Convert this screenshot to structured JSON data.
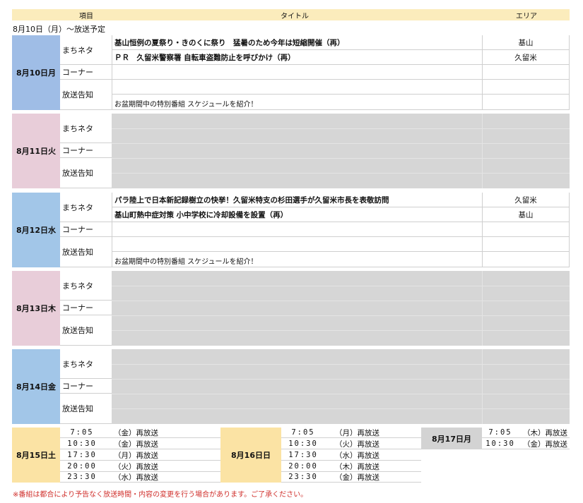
{
  "header": {
    "item": "項目",
    "title": "タイトル",
    "area": "エリア"
  },
  "subtitle": "8月10日（月）～放送予定",
  "categories": {
    "machi": "まちネタ",
    "corner": "コーナー",
    "notice": "放送告知"
  },
  "days": [
    {
      "label": "8月10日月",
      "color": "#9fbde6",
      "machi": [
        {
          "title": "基山恒例の夏祭り・きのくに祭り　猛暑のため今年は短縮開催（再）",
          "area": "基山"
        },
        {
          "title": "ＰＲ　久留米警察署 自転車盗難防止を呼びかけ（再）",
          "area": "久留米"
        }
      ],
      "notice": "お盆期間中の特別番組 スケジュールを紹介！"
    },
    {
      "label": "8月11日火",
      "color": "#e8cdd9"
    },
    {
      "label": "8月12日水",
      "color": "#a2c6e8",
      "machi": [
        {
          "title": "パラ陸上で日本新記録樹立の快挙！久留米特支の杉田選手が久留米市長を表敬訪問",
          "area": "久留米"
        },
        {
          "title": "基山町熱中症対策 小中学校に冷却設備を設置（再）",
          "area": "基山"
        }
      ],
      "notice": "お盆期間中の特別番組 スケジュールを紹介！"
    },
    {
      "label": "8月13日木",
      "color": "#e8cdd9"
    },
    {
      "label": "8月14日金",
      "color": "#a2c6e8"
    }
  ],
  "reruns": [
    {
      "label": "8月15日土",
      "slots": [
        {
          "time": "7:05",
          "note": "（金）再放送"
        },
        {
          "time": "10:30",
          "note": "（金）再放送"
        },
        {
          "time": "17:30",
          "note": "（月）再放送"
        },
        {
          "time": "20:00",
          "note": "（火）再放送"
        },
        {
          "time": "23:30",
          "note": "（水）再放送"
        }
      ]
    },
    {
      "label": "8月16日日",
      "slots": [
        {
          "time": "7:05",
          "note": "（月）再放送"
        },
        {
          "time": "10:30",
          "note": "（火）再放送"
        },
        {
          "time": "17:30",
          "note": "（水）再放送"
        },
        {
          "time": "20:00",
          "note": "（木）再放送"
        },
        {
          "time": "23:30",
          "note": "（金）再放送"
        }
      ]
    },
    {
      "label": "8月17日月",
      "slots": [
        {
          "time": "7:05",
          "note": "（木）再放送"
        },
        {
          "time": "10:30",
          "note": "（金）再放送"
        }
      ]
    }
  ],
  "footnote": "※番組は都合により予告なく放送時間・内容の変更を行う場合があります。ご了承ください。"
}
